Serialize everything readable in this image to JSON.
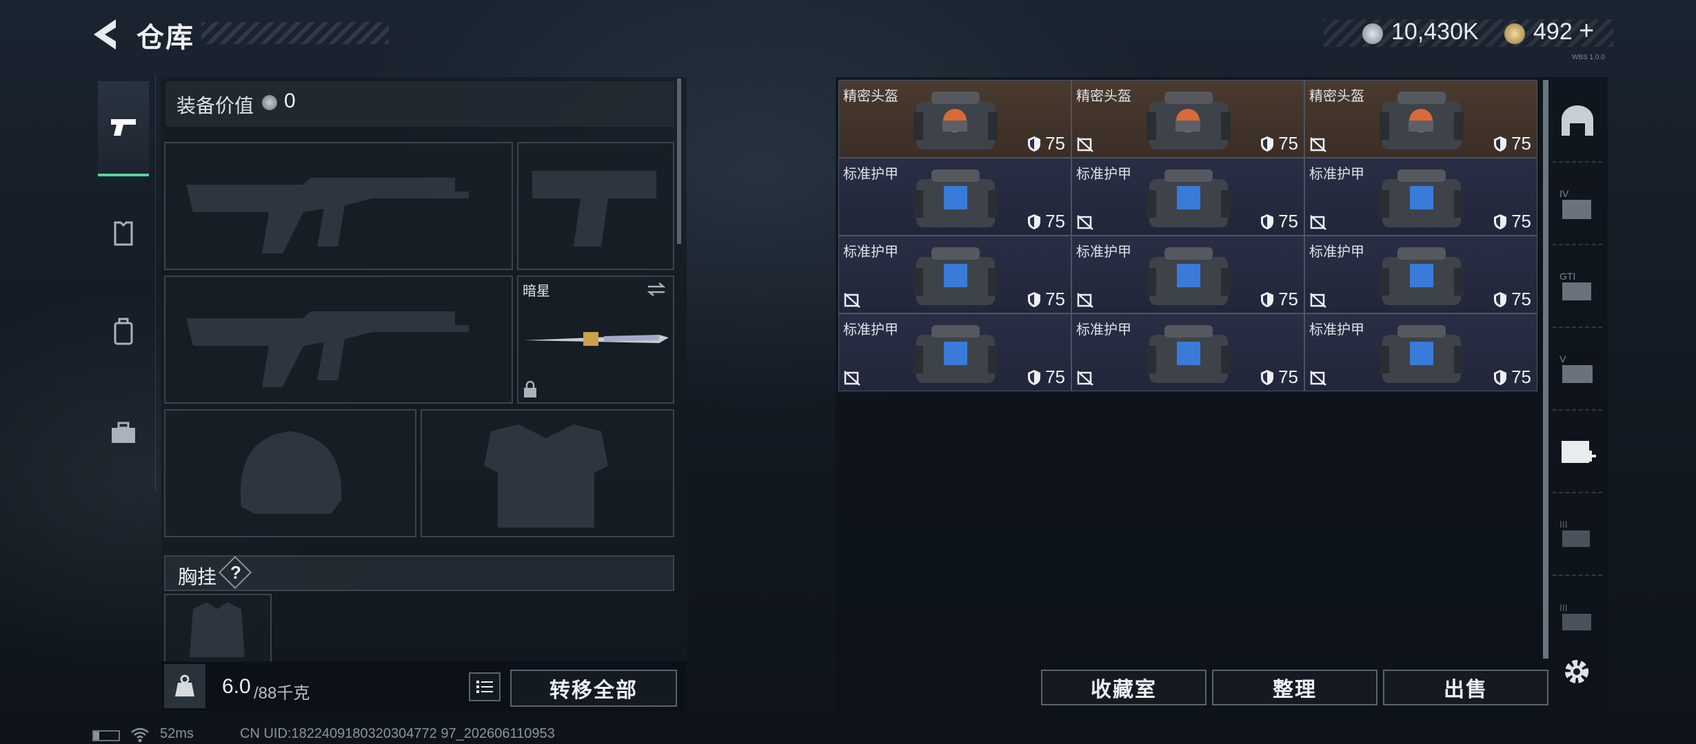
{
  "header": {
    "title": "仓库",
    "currency_1": "10,430K",
    "currency_2": "492",
    "currency_2_add": "+",
    "version": "WBS 1.0.0"
  },
  "loadout": {
    "value_label": "装备价值",
    "value": "0",
    "melee_name": "暗星",
    "chest_rig_label": "胸挂",
    "chest_rig_help": "?",
    "weight_current": "6.0",
    "weight_max": "/88千克",
    "transfer_all": "转移全部"
  },
  "inventory": {
    "items": [
      {
        "name": "精密头盔",
        "type": "helmet",
        "durability": "75",
        "flag": false
      },
      {
        "name": "精密头盔",
        "type": "helmet",
        "durability": "75",
        "flag": true
      },
      {
        "name": "精密头盔",
        "type": "helmet",
        "durability": "75",
        "flag": true
      },
      {
        "name": "标准护甲",
        "type": "armor",
        "durability": "75",
        "flag": false
      },
      {
        "name": "标准护甲",
        "type": "armor",
        "durability": "75",
        "flag": true
      },
      {
        "name": "标准护甲",
        "type": "armor",
        "durability": "75",
        "flag": true
      },
      {
        "name": "标准护甲",
        "type": "armor",
        "durability": "75",
        "flag": true
      },
      {
        "name": "标准护甲",
        "type": "armor",
        "durability": "75",
        "flag": true
      },
      {
        "name": "标准护甲",
        "type": "armor",
        "durability": "75",
        "flag": true
      },
      {
        "name": "标准护甲",
        "type": "armor",
        "durability": "75",
        "flag": true
      },
      {
        "name": "标准护甲",
        "type": "armor",
        "durability": "75",
        "flag": true
      },
      {
        "name": "标准护甲",
        "type": "armor",
        "durability": "75",
        "flag": true
      }
    ],
    "buttons": {
      "collection": "收藏室",
      "sort": "整理",
      "sell": "出售"
    }
  },
  "categories": [
    "IV",
    "GTI",
    "V",
    "III",
    "III"
  ],
  "footer": {
    "ping": "52ms",
    "uid": "CN UID:1822409180320304772 97_202606110953"
  },
  "colors": {
    "accent": "#4fd79a",
    "helmet_bg": "#4a3a2f",
    "armor_bg": "#2a2e45"
  }
}
